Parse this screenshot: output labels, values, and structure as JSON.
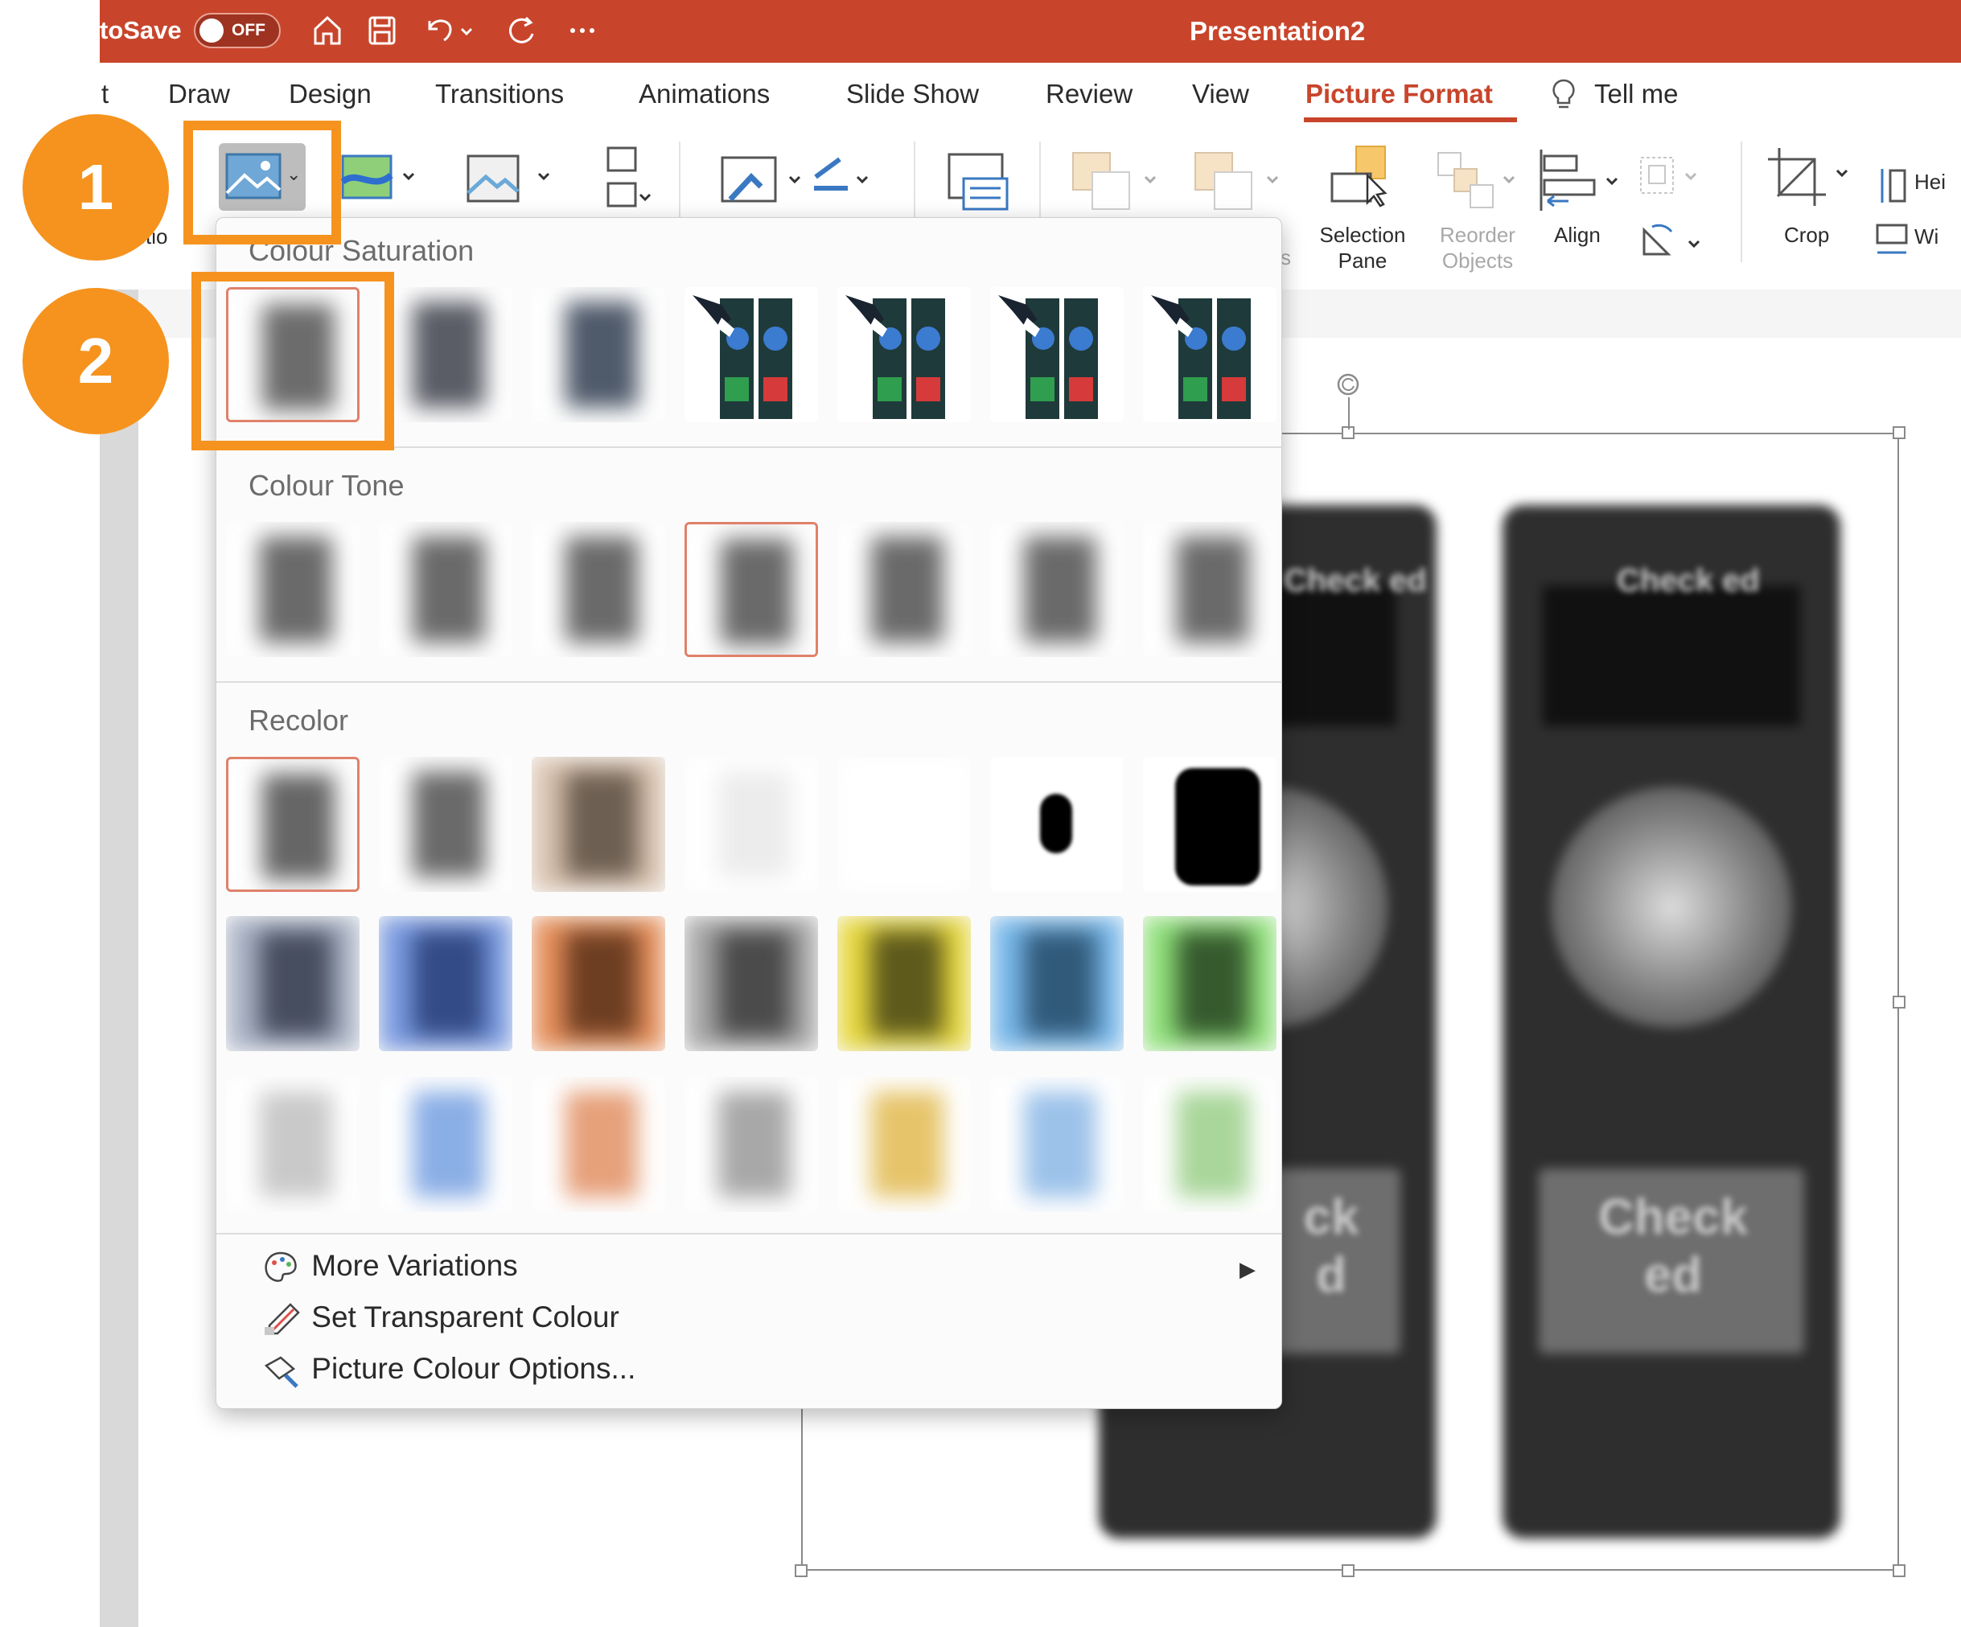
{
  "titlebar": {
    "autosave_label": "toSave",
    "autosave_state": "OFF",
    "title": "Presentation2"
  },
  "tabs": [
    "t",
    "Draw",
    "Design",
    "Transitions",
    "Animations",
    "Slide Show",
    "Review",
    "View",
    "Picture Format",
    "Tell me"
  ],
  "active_tab": "Picture Format",
  "ribbon": {
    "partial_label": "ctio",
    "selection_pane": [
      "Selection",
      "Pane"
    ],
    "reorder_objects": [
      "Reorder",
      "Objects"
    ],
    "align": "Align",
    "crop": "Crop",
    "height_label": "Hei",
    "width_label": "Wi",
    "partial_s": "s"
  },
  "dropdown": {
    "sections": {
      "saturation": "Colour Saturation",
      "tone": "Colour Tone",
      "recolor": "Recolor"
    },
    "menu": {
      "more_variations": "More Variations",
      "set_transparent": "Set Transparent Colour",
      "picture_colour_options": "Picture Colour Options..."
    }
  },
  "slide_image_text": {
    "left_header": "Check ed",
    "right_header": "Check ed",
    "left_button": [
      "ck",
      "d"
    ],
    "right_button": [
      "Check",
      "ed"
    ]
  },
  "callouts": [
    "1",
    "2"
  ],
  "colors": {
    "accent": "#c8452b",
    "callout": "#f5931e",
    "selection_border": "#e0816a"
  },
  "icons": [
    "home-icon",
    "save-icon",
    "undo-icon",
    "redo-icon",
    "more-icon",
    "lightbulb-icon",
    "color-picture-icon",
    "artistic-effects-icon",
    "transparency-icon",
    "compress-icon",
    "change-picture-icon",
    "picture-border-icon",
    "alt-text-icon",
    "selection-pane-icon",
    "align-icon",
    "rotate-icon",
    "crop-icon",
    "height-icon",
    "width-icon",
    "palette-icon",
    "eyedropper-icon",
    "color-options-icon"
  ]
}
